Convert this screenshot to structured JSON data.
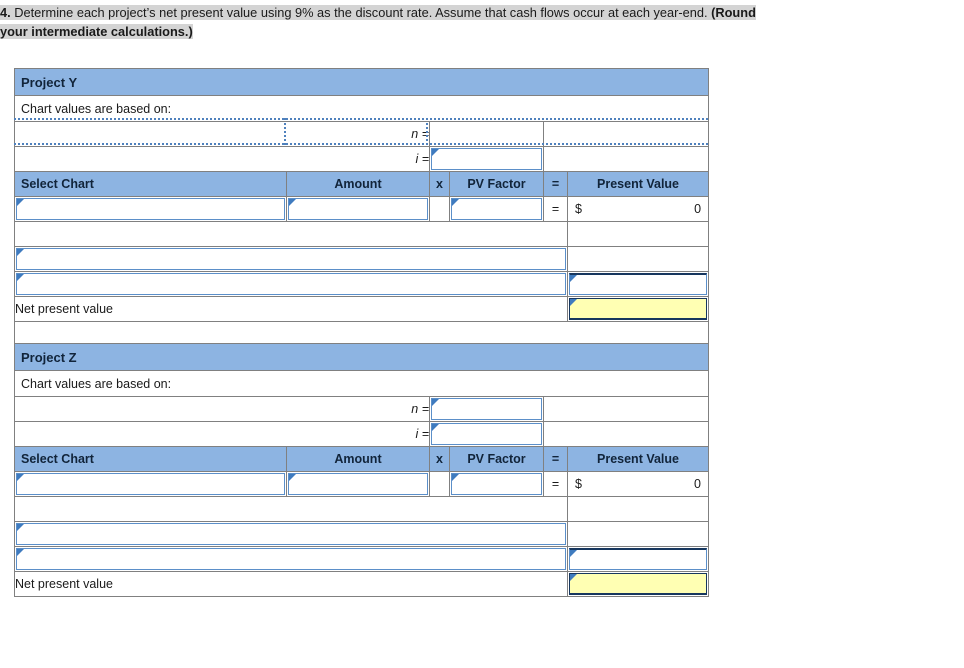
{
  "prompt": {
    "number": "4.",
    "line1_plain": " Determine each project’s net present value using 9% as the discount rate. Assume that cash flows occur at each year-end. ",
    "line1_bold": "(Round",
    "line2_bold": "your intermediate calculations.)"
  },
  "colors": {
    "header_blue": "#8db4e2",
    "input_border": "#5b8fc9",
    "marker_blue": "#3f7bbf",
    "total_border": "#17375e",
    "highlight_yellow": "#ffffb3",
    "text_highlight": "#d4d4d4"
  },
  "columns": {
    "select_chart": "Select Chart",
    "amount": "Amount",
    "times": "x",
    "pv_factor": "PV Factor",
    "equals": "=",
    "present_value": "Present Value"
  },
  "labels": {
    "chart_values_based_on": "Chart values are based on:",
    "n": "n =",
    "i": "i =",
    "net_present_value": "Net present value",
    "dollar_sign": "$",
    "zero": "0",
    "equals_sign": "="
  },
  "projects": [
    {
      "title": "Project Y",
      "chart_values_label": "Chart values are based on:",
      "n_value": "",
      "i_value": "",
      "selected_row_marquee": true,
      "rows": [
        {
          "select_chart": "",
          "amount": "",
          "pv_factor": "",
          "present_value_currency": "$",
          "present_value": "0"
        }
      ],
      "extra_rows": [
        {
          "select_chart": "",
          "present_value": ""
        },
        {
          "select_chart": "",
          "present_value": ""
        }
      ],
      "net_present_value": {
        "label": "Net present value",
        "value": ""
      }
    },
    {
      "title": "Project Z",
      "chart_values_label": "Chart values are based on:",
      "n_value": "",
      "i_value": "",
      "selected_row_marquee": false,
      "rows": [
        {
          "select_chart": "",
          "amount": "",
          "pv_factor": "",
          "present_value_currency": "$",
          "present_value": "0"
        }
      ],
      "extra_rows": [
        {
          "select_chart": "",
          "present_value": ""
        },
        {
          "select_chart": "",
          "present_value": ""
        }
      ],
      "net_present_value": {
        "label": "Net present value",
        "value": ""
      }
    }
  ]
}
